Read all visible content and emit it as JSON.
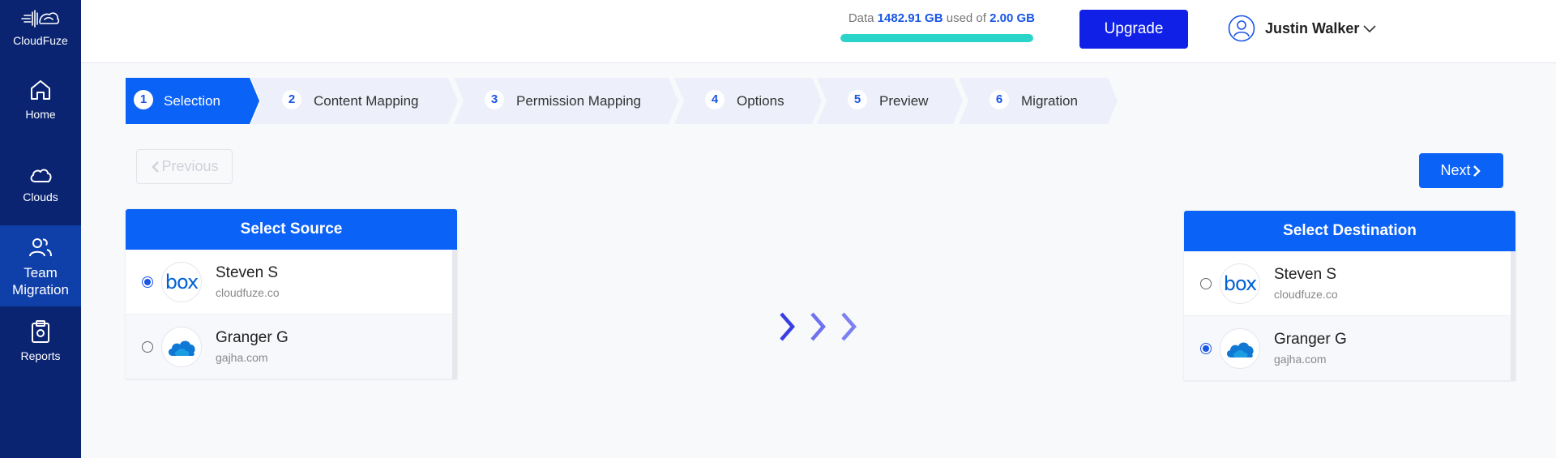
{
  "app": {
    "name": "CloudFuze"
  },
  "sidebar": {
    "items": [
      {
        "label": "Home",
        "icon": "home-icon"
      },
      {
        "label": "Clouds",
        "icon": "cloud-icon"
      },
      {
        "label": "Team Migration",
        "icon": "team-icon",
        "active": true
      },
      {
        "label": "Reports",
        "icon": "clipboard-icon"
      }
    ]
  },
  "header": {
    "usage": {
      "prefix": "Data",
      "used": "1482.91 GB",
      "middle": "used of",
      "total": "2.00 GB",
      "fill_percent": 100
    },
    "upgrade_label": "Upgrade",
    "user_name": "Justin Walker"
  },
  "steps": [
    {
      "num": "1",
      "label": "Selection",
      "active": true
    },
    {
      "num": "2",
      "label": "Content Mapping"
    },
    {
      "num": "3",
      "label": "Permission Mapping"
    },
    {
      "num": "4",
      "label": "Options"
    },
    {
      "num": "5",
      "label": "Preview"
    },
    {
      "num": "6",
      "label": "Migration"
    }
  ],
  "buttons": {
    "previous": "Previous",
    "next": "Next"
  },
  "source": {
    "title": "Select Source",
    "accounts": [
      {
        "name": "Steven S",
        "domain": "cloudfuze.co",
        "provider": "box",
        "logo_text": "box",
        "selected": true
      },
      {
        "name": "Granger G",
        "domain": "gajha.com",
        "provider": "onedrive",
        "selected": false
      }
    ]
  },
  "destination": {
    "title": "Select Destination",
    "accounts": [
      {
        "name": "Steven S",
        "domain": "cloudfuze.co",
        "provider": "box",
        "logo_text": "box",
        "selected": false
      },
      {
        "name": "Granger G",
        "domain": "gajha.com",
        "provider": "onedrive",
        "selected": true
      }
    ]
  },
  "colors": {
    "sidebar": "#0a2472",
    "primary": "#0b62f6",
    "upgrade": "#1020e6",
    "usage_bar": "#2ad4c8"
  }
}
